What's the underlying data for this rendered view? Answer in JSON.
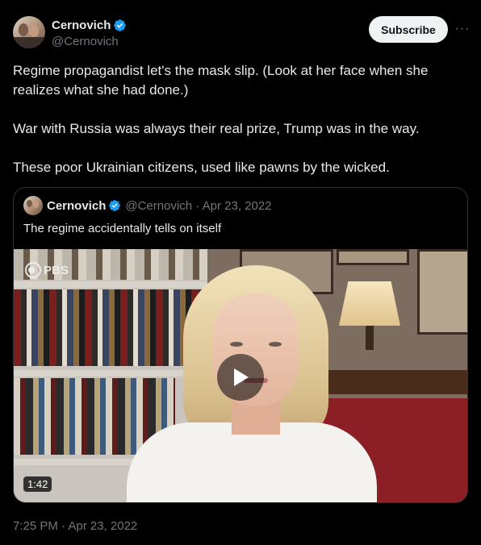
{
  "author": {
    "name": "Cernovich",
    "handle": "@Cernovich"
  },
  "header": {
    "subscribe_label": "Subscribe",
    "more_label": "···"
  },
  "tweet": {
    "paragraphs": [
      "Regime propagandist let's the mask slip. (Look at her face when she realizes what she had done.)",
      "War with Russia was always their real prize, Trump was in the way.",
      "These poor Ukrainian citizens, used like pawns by the wicked."
    ],
    "timestamp": "7:25 PM · Apr 23, 2022"
  },
  "quoted_tweet": {
    "name": "Cernovich",
    "meta": "@Cernovich · Apr 23, 2022",
    "text": "The regime accidentally tells on itself",
    "video": {
      "watermark": "PBS",
      "duration": "1:42"
    }
  },
  "colors": {
    "background": "#000000",
    "text": "#e7e9ea",
    "muted": "#71767b",
    "verified": "#1d9bf0",
    "border": "#2f3336"
  },
  "icons": [
    "verified-badge-icon",
    "more-icon",
    "play-icon",
    "pbs-logo-icon"
  ]
}
